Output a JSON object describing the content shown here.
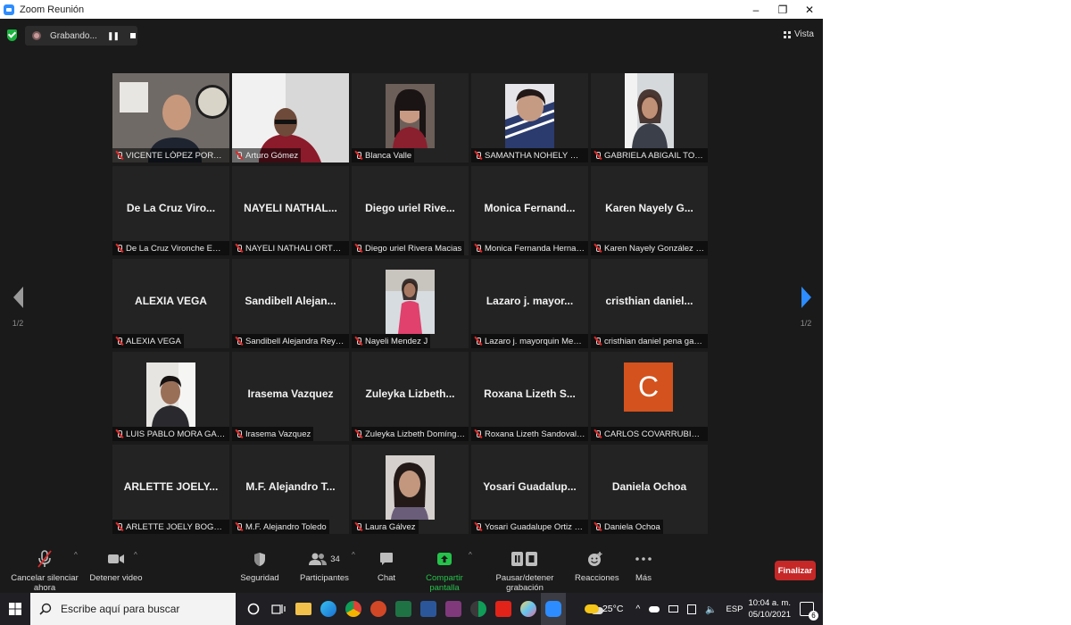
{
  "window": {
    "title": "Zoom Reunión",
    "controls": {
      "minimize": "–",
      "restore": "❐",
      "close": "✕"
    }
  },
  "topbar": {
    "recording_label": "Grabando...",
    "view_label": "Vista"
  },
  "pager": {
    "page": "1/2"
  },
  "participants": [
    {
      "name": "VICENTE LÓPEZ PORTILLO",
      "big": "",
      "video": "vicente"
    },
    {
      "name": "Arturo Gómez",
      "big": "",
      "video": "arturo"
    },
    {
      "name": "Blanca Valle",
      "big": "",
      "video": "blanca"
    },
    {
      "name": "SAMANTHA NOHELY MOY...",
      "big": "",
      "video": "samantha"
    },
    {
      "name": "GABRIELA ABIGAIL TOPETE ...",
      "big": "",
      "video": "gabriela"
    },
    {
      "name": "De La Cruz Vironche Emma...",
      "big": "De La Cruz Viro...",
      "video": ""
    },
    {
      "name": "NAYELI NATHALI ORTEGA A...",
      "big": "NAYELI NATHAL...",
      "video": ""
    },
    {
      "name": "Diego uriel Rivera Macias",
      "big": "Diego uriel Rive...",
      "video": ""
    },
    {
      "name": "Monica Fernanda Hernand...",
      "big": "Monica Fernand...",
      "video": ""
    },
    {
      "name": "Karen Nayely González Ca...",
      "big": "Karen Nayely G...",
      "video": ""
    },
    {
      "name": "ALEXIA VEGA",
      "big": "ALEXIA VEGA",
      "video": ""
    },
    {
      "name": "Sandibell Alejandra Reyes ...",
      "big": "Sandibell Alejan...",
      "video": ""
    },
    {
      "name": "Nayeli Mendez J",
      "big": "",
      "video": "nayeli"
    },
    {
      "name": "Lazaro j. mayorquin Medina",
      "big": "Lazaro j. mayor...",
      "video": ""
    },
    {
      "name": "cristhian daniel pena garcia",
      "big": "cristhian daniel...",
      "video": ""
    },
    {
      "name": "LUIS PABLO MORA GARCIA",
      "big": "",
      "video": "luis"
    },
    {
      "name": "Irasema Vazquez",
      "big": "Irasema Vazquez",
      "video": ""
    },
    {
      "name": "Zuleyka Lizbeth Domínguez...",
      "big": "Zuleyka Lizbeth...",
      "video": ""
    },
    {
      "name": "Roxana Lizeth Sandoval Za...",
      "big": "Roxana Lizeth S...",
      "video": ""
    },
    {
      "name": "CARLOS COVARRUBIAS AR...",
      "big": "",
      "video": "carlos",
      "avatar_letter": "C"
    },
    {
      "name": "ARLETTE JOELY BOGARIN ...",
      "big": "ARLETTE JOELY...",
      "video": ""
    },
    {
      "name": "M.F. Alejandro Toledo",
      "big": "M.F. Alejandro T...",
      "video": ""
    },
    {
      "name": "Laura Gálvez",
      "big": "",
      "video": "laura"
    },
    {
      "name": "Yosari Guadalupe Ortiz Ma...",
      "big": "Yosari Guadalup...",
      "video": ""
    },
    {
      "name": "Daniela Ochoa",
      "big": "Daniela Ochoa",
      "video": ""
    }
  ],
  "toolbar": {
    "mute_label": "Cancelar silenciar ahora",
    "video_label": "Detener video",
    "security_label": "Seguridad",
    "participants_label": "Participantes",
    "participants_count": "34",
    "chat_label": "Chat",
    "share_label": "Compartir pantalla",
    "record_label": "Pausar/detener grabación",
    "reactions_label": "Reacciones",
    "more_label": "Más",
    "end_label": "Finalizar"
  },
  "taskbar": {
    "search_placeholder": "Escribe aquí para buscar",
    "weather": "25°C",
    "language": "ESP",
    "time": "10:04 a. m.",
    "date": "05/10/2021",
    "notifications": "6"
  },
  "colors": {
    "accent": "#2d8cff",
    "share_green": "#25c24a",
    "end_red": "#c62828",
    "active_speaker": "#e6e68a"
  }
}
